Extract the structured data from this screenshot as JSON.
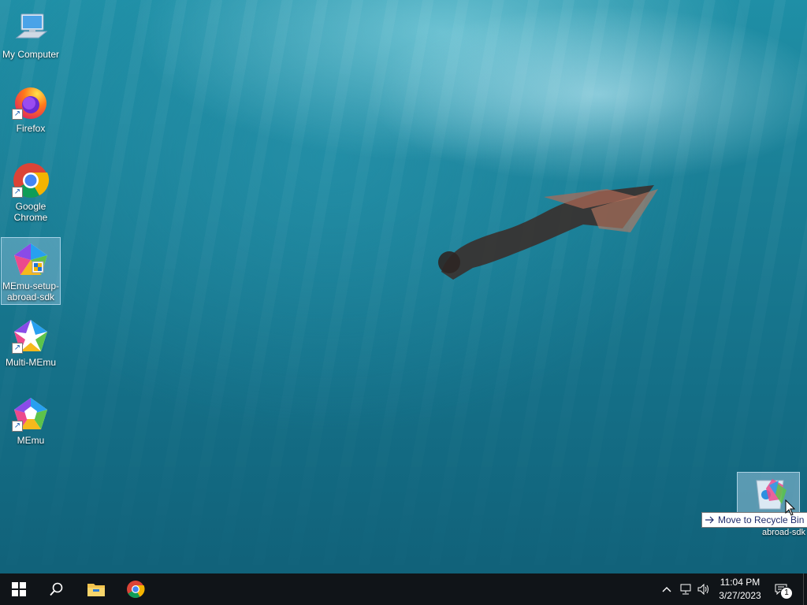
{
  "desktop": {
    "icons": [
      {
        "label": "My Computer",
        "icon": "computer-icon"
      },
      {
        "label": "Firefox",
        "icon": "firefox-icon"
      },
      {
        "label": "Google Chrome",
        "icon": "chrome-icon"
      },
      {
        "label": "MEmu-setup-abroad-sdk",
        "icon": "memu-installer-icon"
      },
      {
        "label": "Multi-MEmu",
        "icon": "multi-memu-icon"
      },
      {
        "label": "MEmu",
        "icon": "memu-icon"
      }
    ],
    "drag": {
      "tooltip": "Move to Recycle Bin",
      "ghost_label": "abroad-sdk",
      "target_icon": "recycle-bin-icon"
    }
  },
  "taskbar": {
    "start_icon": "windows-start-icon",
    "search_icon": "search-icon",
    "pinned": [
      {
        "name": "File Explorer",
        "icon": "file-explorer-icon"
      },
      {
        "name": "Google Chrome",
        "icon": "chrome-icon"
      }
    ],
    "tray": {
      "time": "11:04 PM",
      "date": "3/27/2023",
      "notification_count": "1"
    }
  },
  "colors": {
    "taskbar_bg": "#101418",
    "selection": "#b4d7f0",
    "tooltip_text": "#1f2b6b"
  }
}
